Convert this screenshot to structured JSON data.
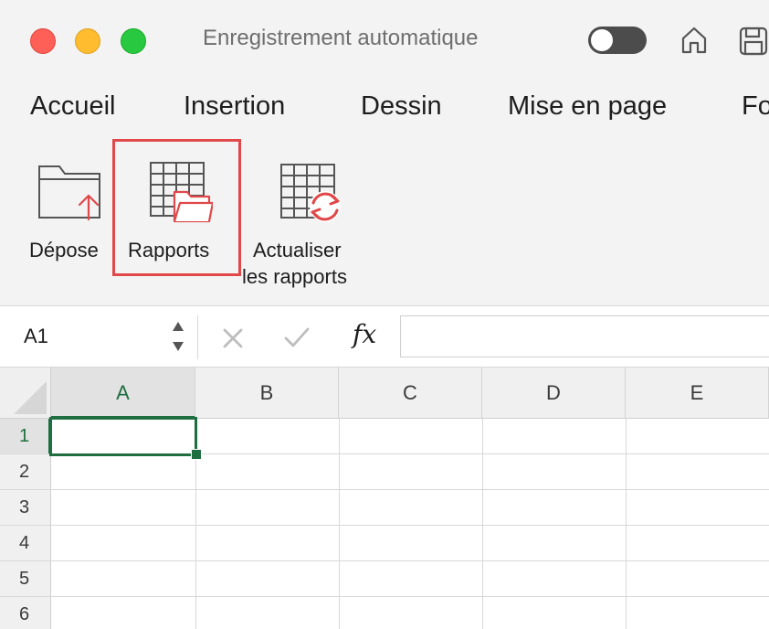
{
  "window": {
    "autosave_label": "Enregistrement automatique",
    "autosave_on": false
  },
  "tabs": [
    {
      "label": "Accueil"
    },
    {
      "label": "Insertion"
    },
    {
      "label": "Dessin"
    },
    {
      "label": "Mise en page"
    },
    {
      "label": "Fo"
    }
  ],
  "ribbon": {
    "upload": {
      "label": "Dépose",
      "icon": "folder-upload-icon"
    },
    "reports": {
      "label": "Rapports",
      "icon": "grid-folder-icon",
      "highlighted": true
    },
    "refresh": {
      "label_line1": "Actualiser",
      "label_line2": "les rapports",
      "icon": "grid-refresh-icon"
    }
  },
  "formula_bar": {
    "name_box": "A1",
    "fx": "fx",
    "formula": ""
  },
  "grid": {
    "columns": [
      "A",
      "B",
      "C",
      "D",
      "E"
    ],
    "rows": [
      "1",
      "2",
      "3",
      "4",
      "5",
      "6"
    ],
    "selected_cell": "A1"
  },
  "colors": {
    "accent_red": "#e0484a",
    "excel_green": "#1e6e40"
  }
}
